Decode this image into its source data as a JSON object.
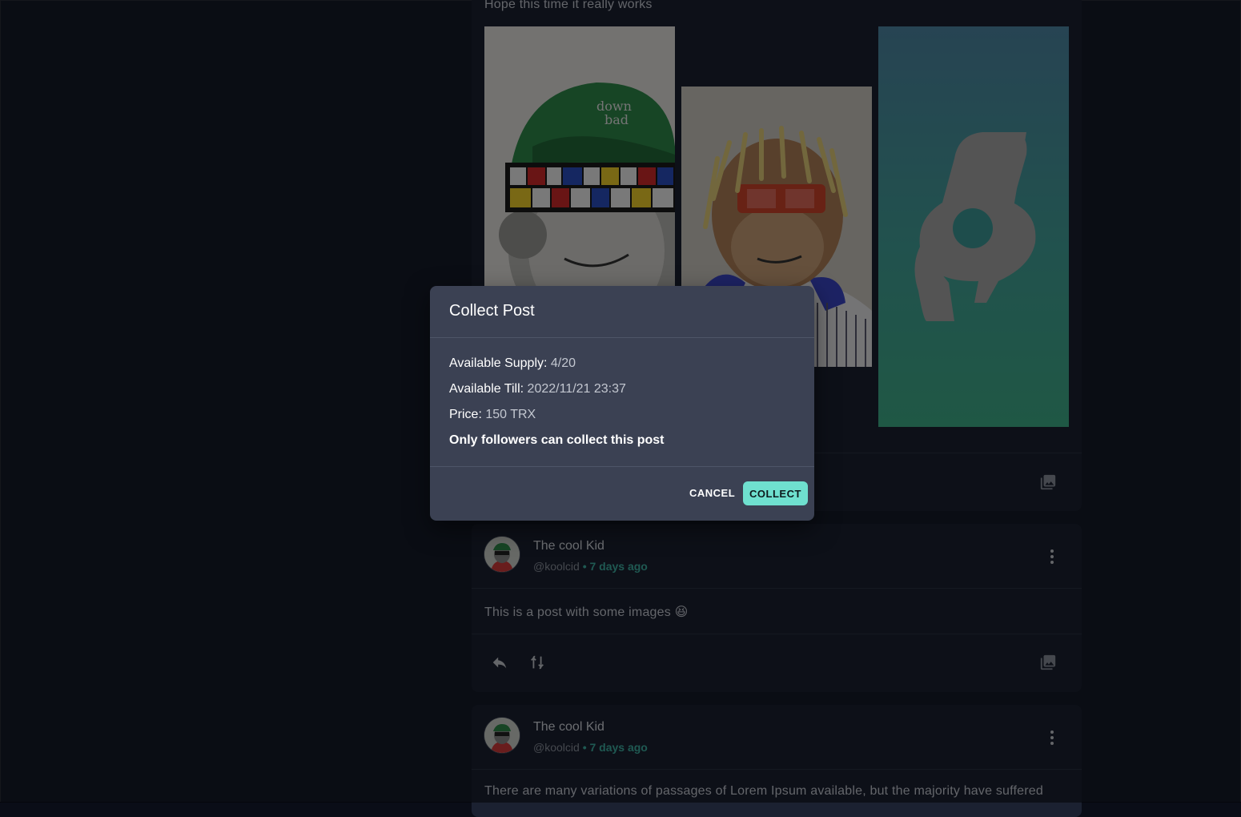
{
  "feed": {
    "posts": [
      {
        "text": "Hope this time it really works",
        "images": [
          "ape-green-cap",
          "ape-dreadlocks",
          "logo-gradient"
        ]
      },
      {
        "author_name": "The cool Kid",
        "handle": "@koolcid",
        "time": "• 7 days ago",
        "text": "This is a post with some images 😆"
      },
      {
        "author_name": "The cool Kid",
        "handle": "@koolcid",
        "time": "• 7 days ago",
        "text": "There are many variations of passages of Lorem Ipsum available, but the majority have suffered"
      }
    ]
  },
  "modal": {
    "title": "Collect Post",
    "supply_label": "Available Supply:",
    "supply_value": "4/20",
    "till_label": "Available Till:",
    "till_value": "2022/11/21 23:37",
    "price_label": "Price:",
    "price_value": "150 TRX",
    "notice": "Only followers can collect this post",
    "cancel_label": "CANCEL",
    "collect_label": "COLLECT"
  },
  "colors": {
    "accent": "#6fe0cf",
    "time_green": "#3fb3a5",
    "modal_bg": "#3b4153",
    "card_bg": "#1b2131"
  },
  "icons": [
    "gallery-icon",
    "reply-icon",
    "mirror-icon",
    "more-vertical-icon"
  ]
}
